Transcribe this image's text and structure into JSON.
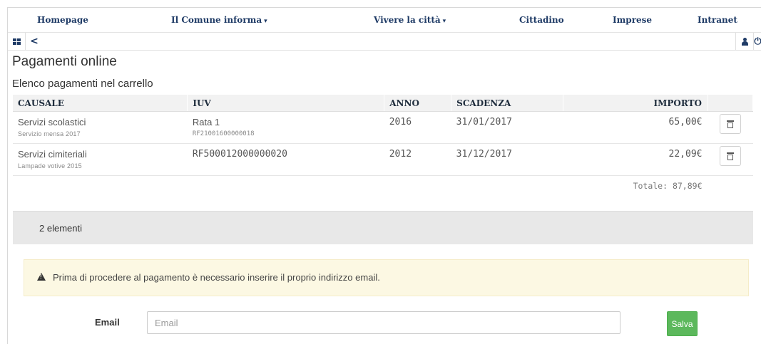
{
  "nav": {
    "items": [
      {
        "label": "Homepage",
        "has_dropdown": false
      },
      {
        "label": "Il Comune informa",
        "has_dropdown": true
      },
      {
        "label": "Vivere la città",
        "has_dropdown": true
      },
      {
        "label": "Cittadino",
        "has_dropdown": false
      },
      {
        "label": "Imprese",
        "has_dropdown": false
      },
      {
        "label": "Intranet",
        "has_dropdown": false
      }
    ],
    "dropdown_glyph": "▾"
  },
  "toolbar": {
    "icons": [
      "apps-grid-icon",
      "back-chevron-icon",
      "user-icon",
      "power-icon"
    ],
    "back_glyph": "<",
    "power_glyph": "⏻"
  },
  "page": {
    "title": "Pagamenti online",
    "section_title": "Elenco pagamenti nel carrello"
  },
  "table": {
    "headers": {
      "causale": "CAUSALE",
      "iuv": "IUV",
      "anno": "ANNO",
      "scadenza": "SCADENZA",
      "importo": "IMPORTO"
    },
    "rows": [
      {
        "causale": "Servizi scolastici",
        "causale_detail": "Servizio mensa 2017",
        "iuv": "Rata 1",
        "iuv_detail": "RF21001600000018",
        "anno": "2016",
        "scadenza": "31/01/2017",
        "scadenza_overdue": true,
        "importo": "65,00€"
      },
      {
        "causale": "Servizi cimiteriali",
        "causale_detail": "Lampade votive 2015",
        "iuv": "RF500012000000020",
        "iuv_detail": "",
        "anno": "2012",
        "scadenza": "31/12/2017",
        "scadenza_overdue": false,
        "importo": "22,09€"
      }
    ],
    "total": "Totale: 87,89€",
    "count": "2 elementi"
  },
  "alert": {
    "icon": "warning-icon",
    "message": "Prima di procedere al pagamento è necessario inserire il proprio indirizzo email."
  },
  "form": {
    "email_label": "Email",
    "email_placeholder": "Email",
    "email_value": "",
    "save_label": "Salva"
  },
  "colors": {
    "nav_text": "#1f3b66",
    "overdue": "#b33a3a",
    "alert_bg": "#fcf8e3",
    "save_button": "#5cb85c"
  }
}
